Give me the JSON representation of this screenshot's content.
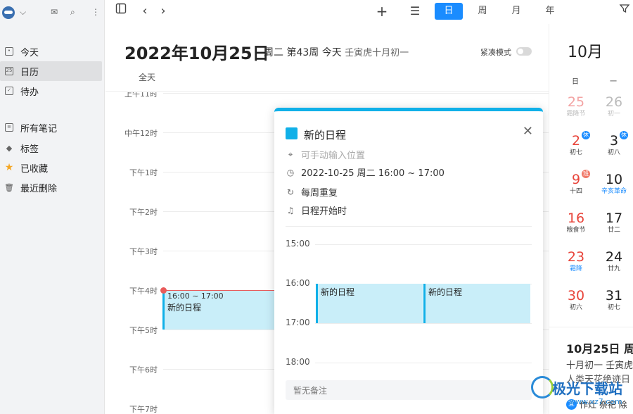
{
  "sidebar": {
    "items": [
      {
        "label": "今天",
        "icon": "today-icon"
      },
      {
        "label": "日历",
        "icon": "calendar-icon",
        "badge": "25"
      },
      {
        "label": "待办",
        "icon": "todo-check-icon"
      },
      {
        "label": "所有笔记",
        "icon": "notes-icon"
      },
      {
        "label": "标签",
        "icon": "tag-icon"
      },
      {
        "label": "已收藏",
        "icon": "star-icon"
      },
      {
        "label": "最近删除",
        "icon": "trash-icon"
      }
    ],
    "today_badge": "25"
  },
  "toolbar": {
    "views": [
      "日",
      "周",
      "月",
      "年"
    ],
    "active_view": "日"
  },
  "header": {
    "date": "2022年10月25日",
    "meta": "周二 第43周 今天",
    "lunar": "壬寅虎十月初一",
    "compact_mode_label": "紧凑模式",
    "all_day_label": "全天"
  },
  "grid": {
    "hours": [
      "上午11时",
      "中午12时",
      "下午1时",
      "下午2时",
      "下午3时",
      "下午4时",
      "下午5时",
      "下午6时",
      "下午7时"
    ],
    "event": {
      "time": "16:00 ~ 17:00",
      "title": "新的日程"
    }
  },
  "popover": {
    "title": "新的日程",
    "location_placeholder": "可手动输入位置",
    "datetime": "2022-10-25 周二 16:00 ~ 17:00",
    "repeat": "每周重复",
    "reminder": "日程开始时",
    "mini_hours": [
      "15:00",
      "16:00",
      "17:00",
      "18:00"
    ],
    "mini_events": [
      "新的日程",
      "新的日程"
    ],
    "note_placeholder": "暂无备注",
    "accent_color": "#10b0e8"
  },
  "right_panel": {
    "month": "10月",
    "weekdays": [
      "日",
      "一"
    ],
    "rows": [
      [
        {
          "d": "25",
          "l": "霜降节",
          "dc": "#f3a3a3",
          "lc": "#bbb"
        },
        {
          "d": "26",
          "l": "初一",
          "dc": "#bbb",
          "lc": "#bbb"
        }
      ],
      [
        {
          "d": "2",
          "l": "初七",
          "dc": "#e8443a",
          "lc": "#444",
          "badge": "休",
          "bc": "#1a8cff"
        },
        {
          "d": "3",
          "l": "初八",
          "dc": "#222",
          "lc": "#444",
          "badge": "休",
          "bc": "#1a8cff"
        }
      ],
      [
        {
          "d": "9",
          "l": "十四",
          "dc": "#e8443a",
          "lc": "#444",
          "badge": "班",
          "bc": "#f07a6a"
        },
        {
          "d": "10",
          "l": "辛亥革命",
          "dc": "#222",
          "lc": "#1a8cff"
        }
      ],
      [
        {
          "d": "16",
          "l": "粮食节",
          "dc": "#e8443a",
          "lc": "#444"
        },
        {
          "d": "17",
          "l": "廿二",
          "dc": "#222",
          "lc": "#444"
        }
      ],
      [
        {
          "d": "23",
          "l": "霜降",
          "dc": "#e8443a",
          "lc": "#1a8cff"
        },
        {
          "d": "24",
          "l": "廿九",
          "dc": "#222",
          "lc": "#444"
        }
      ],
      [
        {
          "d": "30",
          "l": "初六",
          "dc": "#e8443a",
          "lc": "#444"
        },
        {
          "d": "31",
          "l": "初七",
          "dc": "#222",
          "lc": "#444"
        }
      ]
    ],
    "selected_date": "10月25日 周",
    "selected_lunar": "十月初一 壬寅虎",
    "selected_note": "人类天花绝迹日",
    "yi_label": "宜",
    "yi_text": "作灶 祭祀 除"
  },
  "watermark": {
    "text": "极光下载站",
    "url": "www.xz7.com"
  }
}
